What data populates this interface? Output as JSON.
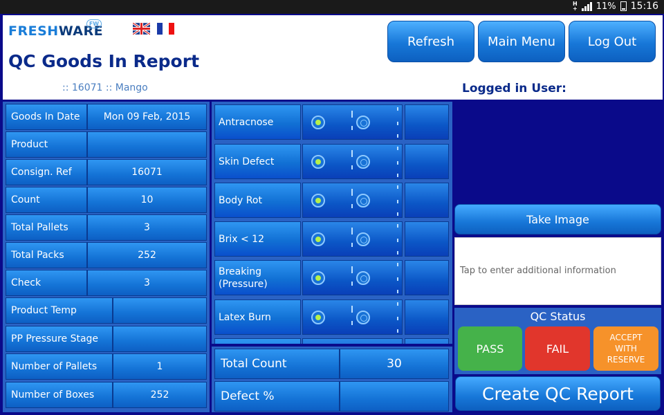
{
  "statusbar": {
    "network": "H",
    "network_sub": "+",
    "battery": "11%",
    "time": "15:16"
  },
  "header": {
    "logo_part1": "FRESH",
    "logo_part2": "WARE",
    "logo_badge": "FW",
    "title": "QC Goods In Report",
    "record_info": ":: 16071  ::  Mango",
    "logged_in_label": "Logged in User:",
    "buttons": {
      "refresh": "Refresh",
      "main_menu": "Main Menu",
      "log_out": "Log Out"
    }
  },
  "details": [
    {
      "label": "Goods In Date",
      "value": "Mon 09 Feb, 2015"
    },
    {
      "label": "Product",
      "value": ""
    },
    {
      "label": "Consign. Ref",
      "value": "16071"
    },
    {
      "label": "Count",
      "value": "10"
    },
    {
      "label": "Total Pallets",
      "value": "3"
    },
    {
      "label": "Total Packs",
      "value": "252"
    },
    {
      "label": "Check",
      "value": "3"
    },
    {
      "label": "Product Temp",
      "value": ""
    },
    {
      "label": "PP Pressure Stage",
      "value": ""
    },
    {
      "label": "Number of Pallets",
      "value": "1"
    },
    {
      "label": "Number of Boxes",
      "value": "252"
    }
  ],
  "defects": [
    {
      "name": "Antracnose",
      "selected": "first"
    },
    {
      "name": "Skin Defect",
      "selected": "first"
    },
    {
      "name": "Body Rot",
      "selected": "first"
    },
    {
      "name": "Brix < 12",
      "selected": "first"
    },
    {
      "name": "Breaking (Pressure)",
      "selected": "first"
    },
    {
      "name": "Latex Burn",
      "selected": "first"
    }
  ],
  "totals": {
    "total_count_label": "Total Count",
    "total_count_value": "30",
    "defect_pct_label": "Defect %",
    "defect_pct_value": ""
  },
  "side": {
    "take_image": "Take Image",
    "notes_placeholder": "Tap to enter additional information",
    "qc_status_title": "QC Status",
    "pass": "PASS",
    "fail": "FAIL",
    "accept": "ACCEPT\nWITH\nRESERVE",
    "create_report": "Create QC Report"
  },
  "colors": {
    "background": "#0a0a8a",
    "pass": "#45b24a",
    "fail": "#e1362c",
    "accept": "#f6922a"
  }
}
